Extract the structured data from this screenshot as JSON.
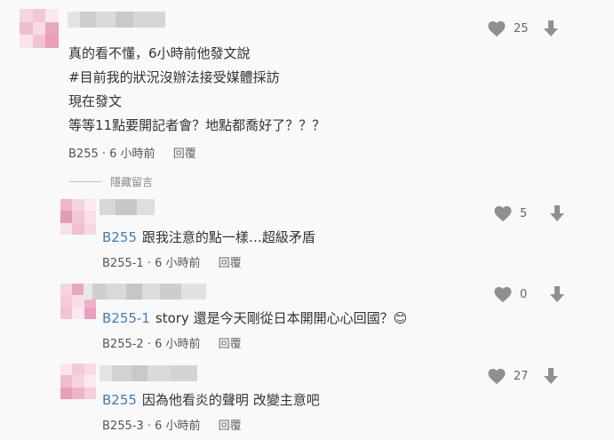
{
  "comments": [
    {
      "lines": [
        "真的看不懂，6小時前他發文說",
        "#目前我的狀況沒辦法接受媒體採訪",
        "現在發文",
        "等等11點要開記者會？地點都喬好了？？？"
      ],
      "author": "B255",
      "time": "6 小時前",
      "reply_label": "回覆",
      "likes": "25"
    }
  ],
  "hidden_label": "隱藏留言",
  "replies": [
    {
      "mention": "B255",
      "text": "跟我注意的點一樣…超級矛盾",
      "author": "B255-1",
      "time": "6 小時前",
      "reply_label": "回覆",
      "likes": "5"
    },
    {
      "mention": "B255-1",
      "text": "story 還是今天剛從日本開開心心回國？😊",
      "author": "B255-2",
      "time": "6 小時前",
      "reply_label": "回覆",
      "likes": "0"
    },
    {
      "mention": "B255",
      "text": "因為他看炎的聲明 改變主意吧",
      "author": "B255-3",
      "time": "6 小時前",
      "reply_label": "回覆",
      "likes": "27"
    }
  ],
  "colors": {
    "mention": "#3f7fb7",
    "icon": "#909090",
    "avatar_pink": "#e8a2bc"
  },
  "icons": {
    "like": "heart-icon",
    "dislike": "thumb-down-arrow-icon"
  }
}
